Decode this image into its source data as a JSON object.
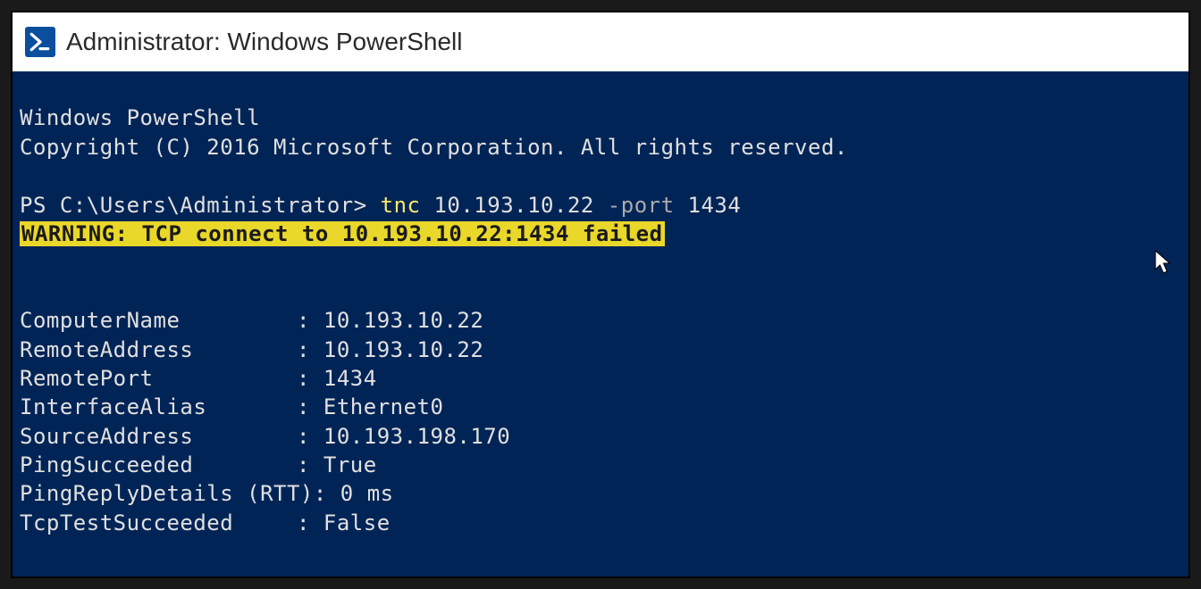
{
  "window": {
    "title": "Administrator: Windows PowerShell"
  },
  "banner": {
    "line1": "Windows PowerShell",
    "line2": "Copyright (C) 2016 Microsoft Corporation. All rights reserved."
  },
  "prompt_line": {
    "prompt": "PS C:\\Users\\Administrator>",
    "command": "tnc",
    "arg1": "10.193.10.22",
    "param": "-port",
    "arg2": "1434"
  },
  "warning": "WARNING: TCP connect to 10.193.10.22:1434 failed",
  "results": [
    {
      "key": "ComputerName",
      "value": "10.193.10.22"
    },
    {
      "key": "RemoteAddress",
      "value": "10.193.10.22"
    },
    {
      "key": "RemotePort",
      "value": "1434"
    },
    {
      "key": "InterfaceAlias",
      "value": "Ethernet0"
    },
    {
      "key": "SourceAddress",
      "value": "10.193.198.170"
    },
    {
      "key": "PingSucceeded",
      "value": "True"
    },
    {
      "key": "PingReplyDetails (RTT)",
      "value": "0 ms"
    },
    {
      "key": "TcpTestSucceeded",
      "value": "False"
    }
  ]
}
